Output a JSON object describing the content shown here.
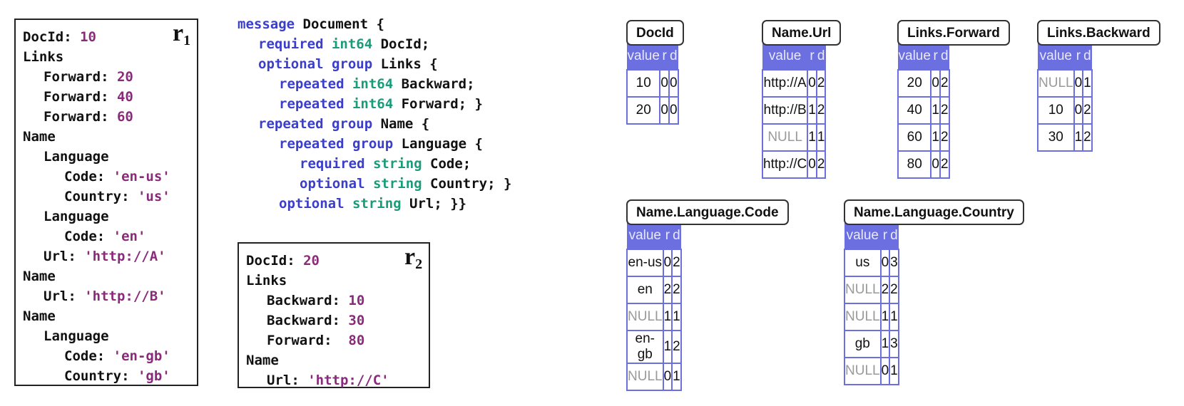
{
  "record1": {
    "label": "r",
    "label_sub": "1",
    "lines": [
      {
        "indent": 0,
        "key": "DocId:",
        "value": "10"
      },
      {
        "indent": 0,
        "key": "Links",
        "value": ""
      },
      {
        "indent": 1,
        "key": "Forward:",
        "value": "20"
      },
      {
        "indent": 1,
        "key": "Forward:",
        "value": "40"
      },
      {
        "indent": 1,
        "key": "Forward:",
        "value": "60"
      },
      {
        "indent": 0,
        "key": "Name",
        "value": ""
      },
      {
        "indent": 1,
        "key": "Language",
        "value": ""
      },
      {
        "indent": 2,
        "key": "Code:",
        "value": "'en-us'"
      },
      {
        "indent": 2,
        "key": "Country:",
        "value": "'us'"
      },
      {
        "indent": 1,
        "key": "Language",
        "value": ""
      },
      {
        "indent": 2,
        "key": "Code:",
        "value": "'en'"
      },
      {
        "indent": 1,
        "key": "Url:",
        "value": "'http://A'"
      },
      {
        "indent": 0,
        "key": "Name",
        "value": ""
      },
      {
        "indent": 1,
        "key": "Url:",
        "value": "'http://B'"
      },
      {
        "indent": 0,
        "key": "Name",
        "value": ""
      },
      {
        "indent": 1,
        "key": "Language",
        "value": ""
      },
      {
        "indent": 2,
        "key": "Code:",
        "value": "'en-gb'"
      },
      {
        "indent": 2,
        "key": "Country:",
        "value": "'gb'"
      }
    ]
  },
  "record2": {
    "label": "r",
    "label_sub": "2",
    "lines": [
      {
        "indent": 0,
        "key": "DocId:",
        "value": "20"
      },
      {
        "indent": 0,
        "key": "Links",
        "value": ""
      },
      {
        "indent": 1,
        "key": "Backward:",
        "value": "10"
      },
      {
        "indent": 1,
        "key": "Backward:",
        "value": "30"
      },
      {
        "indent": 1,
        "key": "Forward:",
        "value": " 80"
      },
      {
        "indent": 0,
        "key": "Name",
        "value": ""
      },
      {
        "indent": 1,
        "key": "Url:",
        "value": "'http://C'"
      }
    ]
  },
  "schema": {
    "lines": [
      {
        "indent": 0,
        "parts": [
          [
            "kw",
            "message "
          ],
          [
            "nm",
            "Document {"
          ]
        ]
      },
      {
        "indent": 1,
        "parts": [
          [
            "kw",
            "required "
          ],
          [
            "ty",
            "int64 "
          ],
          [
            "nm",
            "DocId;"
          ]
        ]
      },
      {
        "indent": 1,
        "parts": [
          [
            "kw",
            "optional group "
          ],
          [
            "nm",
            "Links {"
          ]
        ]
      },
      {
        "indent": 2,
        "parts": [
          [
            "kw",
            "repeated "
          ],
          [
            "ty",
            "int64 "
          ],
          [
            "nm",
            "Backward;"
          ]
        ]
      },
      {
        "indent": 2,
        "parts": [
          [
            "kw",
            "repeated "
          ],
          [
            "ty",
            "int64 "
          ],
          [
            "nm",
            "Forward; }"
          ]
        ]
      },
      {
        "indent": 1,
        "parts": [
          [
            "kw",
            "repeated group "
          ],
          [
            "nm",
            "Name {"
          ]
        ]
      },
      {
        "indent": 2,
        "parts": [
          [
            "kw",
            "repeated group "
          ],
          [
            "nm",
            "Language {"
          ]
        ]
      },
      {
        "indent": 3,
        "parts": [
          [
            "kw",
            "required "
          ],
          [
            "ty",
            "string "
          ],
          [
            "nm",
            "Code;"
          ]
        ]
      },
      {
        "indent": 3,
        "parts": [
          [
            "kw",
            "optional "
          ],
          [
            "ty",
            "string "
          ],
          [
            "nm",
            "Country; }"
          ]
        ]
      },
      {
        "indent": 2,
        "parts": [
          [
            "kw",
            "optional "
          ],
          [
            "ty",
            "string "
          ],
          [
            "nm",
            "Url; }}"
          ]
        ]
      }
    ]
  },
  "headers": {
    "value": "value",
    "r": "r",
    "d": "d"
  },
  "null_text": "NULL",
  "columns": [
    {
      "id": "docid",
      "title": "DocId",
      "rows": [
        [
          "10",
          "0",
          "0"
        ],
        [
          "20",
          "0",
          "0"
        ]
      ]
    },
    {
      "id": "name-url",
      "title": "Name.Url",
      "rows": [
        [
          "http://A",
          "0",
          "2"
        ],
        [
          "http://B",
          "1",
          "2"
        ],
        [
          "NULL",
          "1",
          "1"
        ],
        [
          "http://C",
          "0",
          "2"
        ]
      ]
    },
    {
      "id": "links-forward",
      "title": "Links.Forward",
      "rows": [
        [
          "20",
          "0",
          "2"
        ],
        [
          "40",
          "1",
          "2"
        ],
        [
          "60",
          "1",
          "2"
        ],
        [
          "80",
          "0",
          "2"
        ]
      ]
    },
    {
      "id": "links-backward",
      "title": "Links.Backward",
      "rows": [
        [
          "NULL",
          "0",
          "1"
        ],
        [
          "10",
          "0",
          "2"
        ],
        [
          "30",
          "1",
          "2"
        ]
      ]
    },
    {
      "id": "name-language-code",
      "title": "Name.Language.Code",
      "rows": [
        [
          "en-us",
          "0",
          "2"
        ],
        [
          "en",
          "2",
          "2"
        ],
        [
          "NULL",
          "1",
          "1"
        ],
        [
          "en-gb",
          "1",
          "2"
        ],
        [
          "NULL",
          "0",
          "1"
        ]
      ]
    },
    {
      "id": "name-language-country",
      "title": "Name.Language.Country",
      "rows": [
        [
          "us",
          "0",
          "3"
        ],
        [
          "NULL",
          "2",
          "2"
        ],
        [
          "NULL",
          "1",
          "1"
        ],
        [
          "gb",
          "1",
          "3"
        ],
        [
          "NULL",
          "0",
          "1"
        ]
      ]
    }
  ]
}
